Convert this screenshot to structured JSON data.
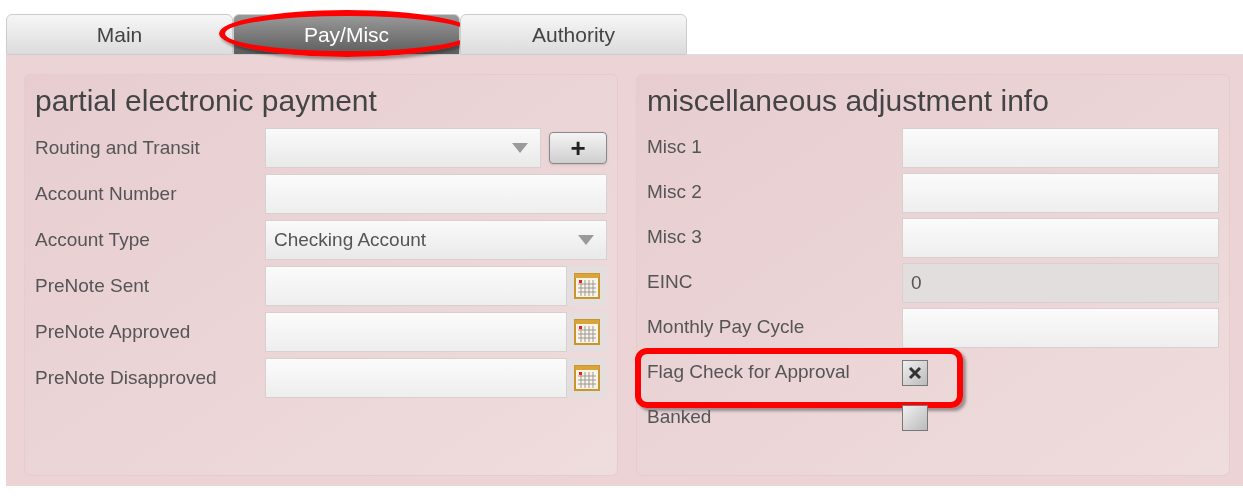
{
  "tabs": [
    {
      "label": "Main",
      "selected": false,
      "highlighted": false
    },
    {
      "label": "Pay/Misc",
      "selected": true,
      "highlighted": true
    },
    {
      "label": "Authority",
      "selected": false,
      "highlighted": false
    }
  ],
  "left_panel": {
    "title": "partial electronic payment",
    "fields": [
      {
        "label": "Routing and Transit",
        "kind": "combo_add",
        "add_button": "+"
      },
      {
        "label": "Account Number",
        "kind": "text"
      },
      {
        "label": "Account Type",
        "kind": "combo",
        "value": "Checking Account"
      },
      {
        "label": "PreNote Sent",
        "kind": "date"
      },
      {
        "label": "PreNote Approved",
        "kind": "date"
      },
      {
        "label": "PreNote Disapproved",
        "kind": "date"
      }
    ]
  },
  "right_panel": {
    "title": "miscellaneous adjustment info",
    "fields": [
      {
        "label": "Misc 1",
        "kind": "text",
        "disabled": false
      },
      {
        "label": "Misc 2",
        "kind": "text",
        "disabled": false
      },
      {
        "label": "Misc 3",
        "kind": "text",
        "disabled": false
      },
      {
        "label": "EINC",
        "kind": "text",
        "value": "0",
        "disabled": true
      },
      {
        "label": "Monthly Pay Cycle",
        "kind": "text",
        "disabled": false
      },
      {
        "label": "Flag Check for Approval",
        "kind": "checkbox",
        "checked": true,
        "highlighted": true
      },
      {
        "label": "Banked",
        "kind": "checkbox",
        "checked": false,
        "highlighted": false
      }
    ]
  }
}
